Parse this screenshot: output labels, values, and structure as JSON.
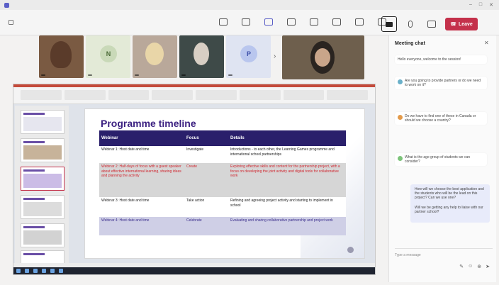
{
  "window": {
    "title": "",
    "controls": [
      "–",
      "□",
      "✕"
    ]
  },
  "toolbar": {
    "timer": "",
    "tools": [
      {
        "icon": "people-icon",
        "label": ""
      },
      {
        "icon": "chat-icon",
        "label": ""
      },
      {
        "icon": "hand-icon",
        "label": ""
      },
      {
        "icon": "reactions-icon",
        "label": ""
      },
      {
        "icon": "view-icon",
        "label": ""
      },
      {
        "icon": "notes-icon",
        "label": ""
      },
      {
        "icon": "apps-icon",
        "label": ""
      },
      {
        "icon": "more-icon",
        "label": ""
      }
    ],
    "leave_label": "Leave",
    "accent": "#5b5fc7",
    "leave_color": "#c4314b"
  },
  "videos": [
    {
      "initial": "",
      "name": "",
      "bg": "#7a5a42"
    },
    {
      "initial": "N",
      "name": "",
      "bg": "#e3ead7",
      "avatar_bg": "#c9d9b8",
      "avatar_fg": "#4a6a36"
    },
    {
      "initial": "",
      "name": "",
      "bg": "#b9a89a"
    },
    {
      "initial": "",
      "name": "",
      "bg": "#3e4a48"
    },
    {
      "initial": "P",
      "name": "",
      "bg": "#dfe4f2",
      "avatar_bg": "#b9c6ee",
      "avatar_fg": "#3c4fa8"
    }
  ],
  "slide": {
    "title": "Programme timeline",
    "headers": [
      "Webinar",
      "Focus",
      "Details"
    ],
    "rows": [
      {
        "webinar": "Webinar 1: Host date and time",
        "focus": "Investigate",
        "details": "Introductions - to each other, the Learning Games programme and international school partnerships"
      },
      {
        "webinar": "Webinar 2: Half-days of focus with a guest speaker about effective international learning, sharing ideas and planning the activity",
        "focus": "Create",
        "details": "Exploring effective skills and content for the partnership project, with a focus on developing the joint activity and digital tools for collaborative work"
      },
      {
        "webinar": "Webinar 3: Host date and time",
        "focus": "Take action",
        "details": "Refining and agreeing project activity and starting to implement in school"
      },
      {
        "webinar": "Webinar 4: Host date and time",
        "focus": "Celebrate",
        "details": "Evaluating and sharing collaborative partnership and project work"
      }
    ],
    "link": "",
    "title_color": "#3a1f80",
    "header_color": "#2a1f6b"
  },
  "chat": {
    "title": "Meeting chat",
    "messages": [
      {
        "meta": "",
        "text": "Hello everyone, welcome to the session!"
      },
      {
        "meta": "",
        "text": "Are you going to provide partners or do we need to work on it?"
      },
      {
        "meta": "",
        "text": "Do we have to find one of these in Canada or should we choose a country?"
      },
      {
        "meta": "",
        "text": "What is the age group of students we can consider?"
      }
    ],
    "own_messages": [
      "How will we choose the best application and the students who will be the lead on this project? Can we use one?",
      "Will we be getting any help to liaise with our partner school?"
    ],
    "compose_placeholder": "Type a message"
  }
}
